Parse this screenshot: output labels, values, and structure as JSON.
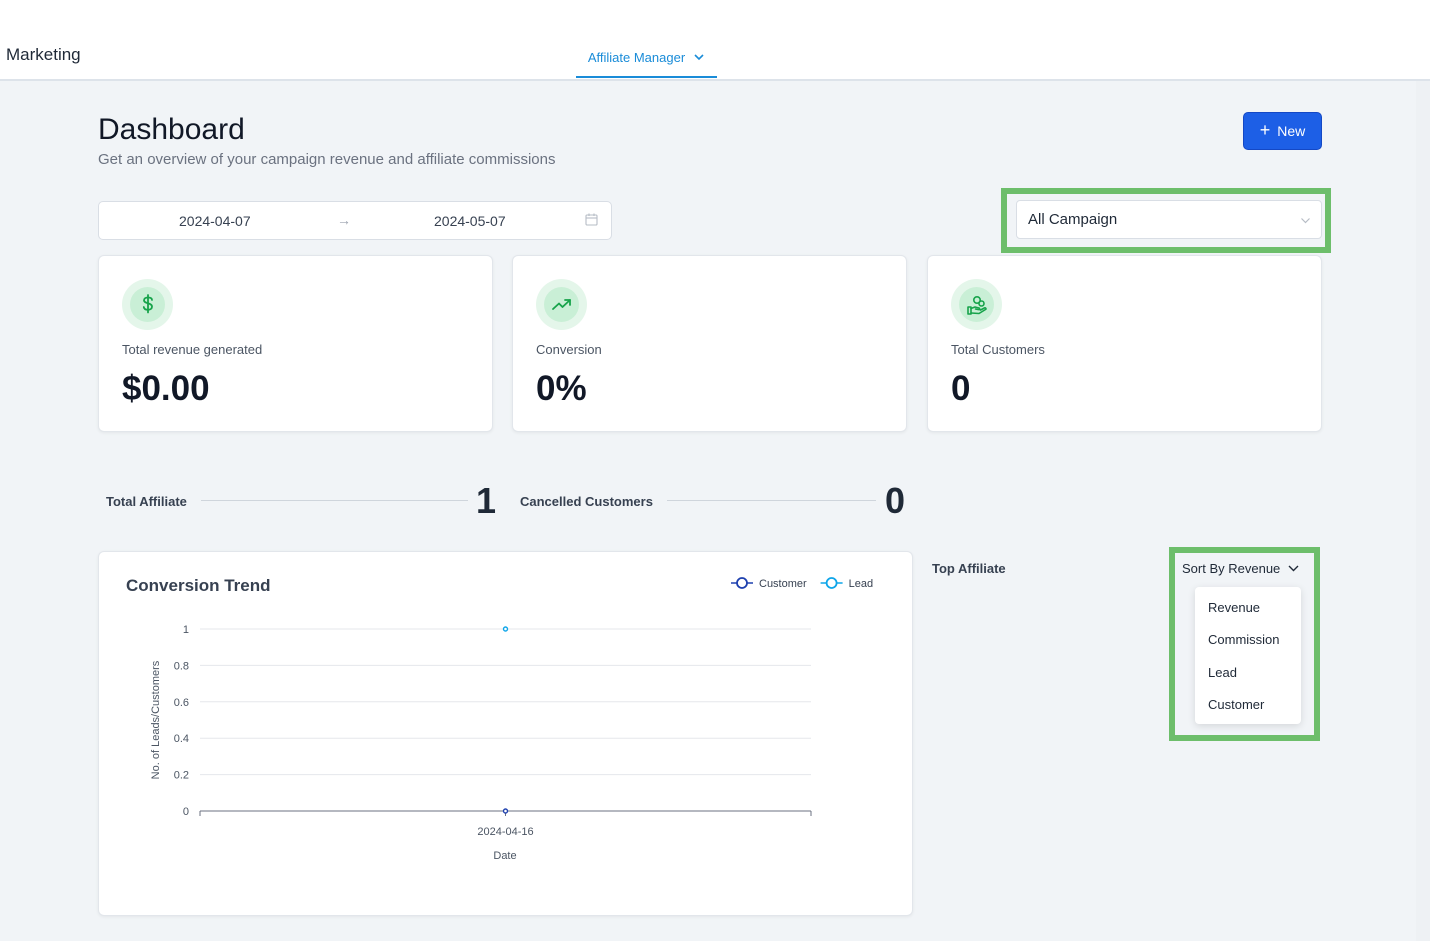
{
  "brand": "Marketing",
  "nav": {
    "active_tab": "Affiliate Manager",
    "chevron_icon": "chevron-down-icon"
  },
  "header": {
    "title": "Dashboard",
    "subtitle": "Get an overview of your campaign revenue and affiliate commissions",
    "new_button": "New"
  },
  "date_range": {
    "start": "2024-04-07",
    "arrow": "→",
    "end": "2024-05-07"
  },
  "campaign_filter": {
    "value": "All Campaign"
  },
  "stats": [
    {
      "icon": "dollar-icon",
      "label": "Total revenue generated",
      "value": "$0.00"
    },
    {
      "icon": "trending-up-icon",
      "label": "Conversion",
      "value": "0%"
    },
    {
      "icon": "customers-icon",
      "label": "Total Customers",
      "value": "0"
    }
  ],
  "totals": {
    "affiliate_label": "Total Affiliate",
    "affiliate_value": "1",
    "cancelled_label": "Cancelled Customers",
    "cancelled_value": "0"
  },
  "colors": {
    "accent": "#1a8cd8",
    "primary_button": "#1d5fe6",
    "icon_green": "#16a34a",
    "highlight_box": "#6dbe6b"
  },
  "chart_data": {
    "type": "line",
    "title": "Conversion Trend",
    "xlabel": "Date",
    "ylabel": "No. of Leads/Customers",
    "x": [
      "2024-04-16"
    ],
    "ylim": [
      0,
      1
    ],
    "yticks": [
      "0",
      "0.2",
      "0.4",
      "0.6",
      "0.8",
      "1"
    ],
    "grid": true,
    "legend_position": "top-right",
    "series": [
      {
        "name": "Customer",
        "values": [
          0
        ],
        "color": "#1e40af"
      },
      {
        "name": "Lead",
        "values": [
          1
        ],
        "color": "#0ea5e9"
      }
    ]
  },
  "top_affiliate": {
    "label": "Top Affiliate",
    "sort_label": "Sort By Revenue",
    "options": [
      "Revenue",
      "Commission",
      "Lead",
      "Customer"
    ]
  }
}
